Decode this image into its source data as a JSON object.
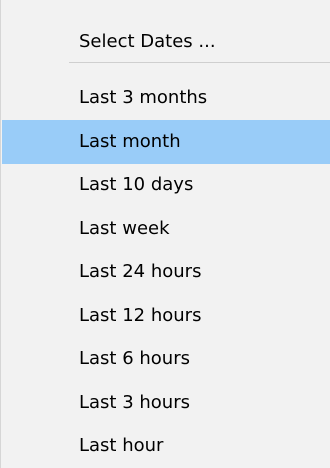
{
  "menu": {
    "header_item": "Select Dates ...",
    "items": [
      {
        "label": "Last 3 months",
        "highlighted": false
      },
      {
        "label": "Last month",
        "highlighted": true
      },
      {
        "label": "Last 10 days",
        "highlighted": false
      },
      {
        "label": "Last week",
        "highlighted": false
      },
      {
        "label": "Last 24 hours",
        "highlighted": false
      },
      {
        "label": "Last 12 hours",
        "highlighted": false
      },
      {
        "label": "Last 6 hours",
        "highlighted": false
      },
      {
        "label": "Last 3 hours",
        "highlighted": false
      },
      {
        "label": "Last hour",
        "highlighted": false
      }
    ],
    "highlight_color": "#99ccf8"
  }
}
